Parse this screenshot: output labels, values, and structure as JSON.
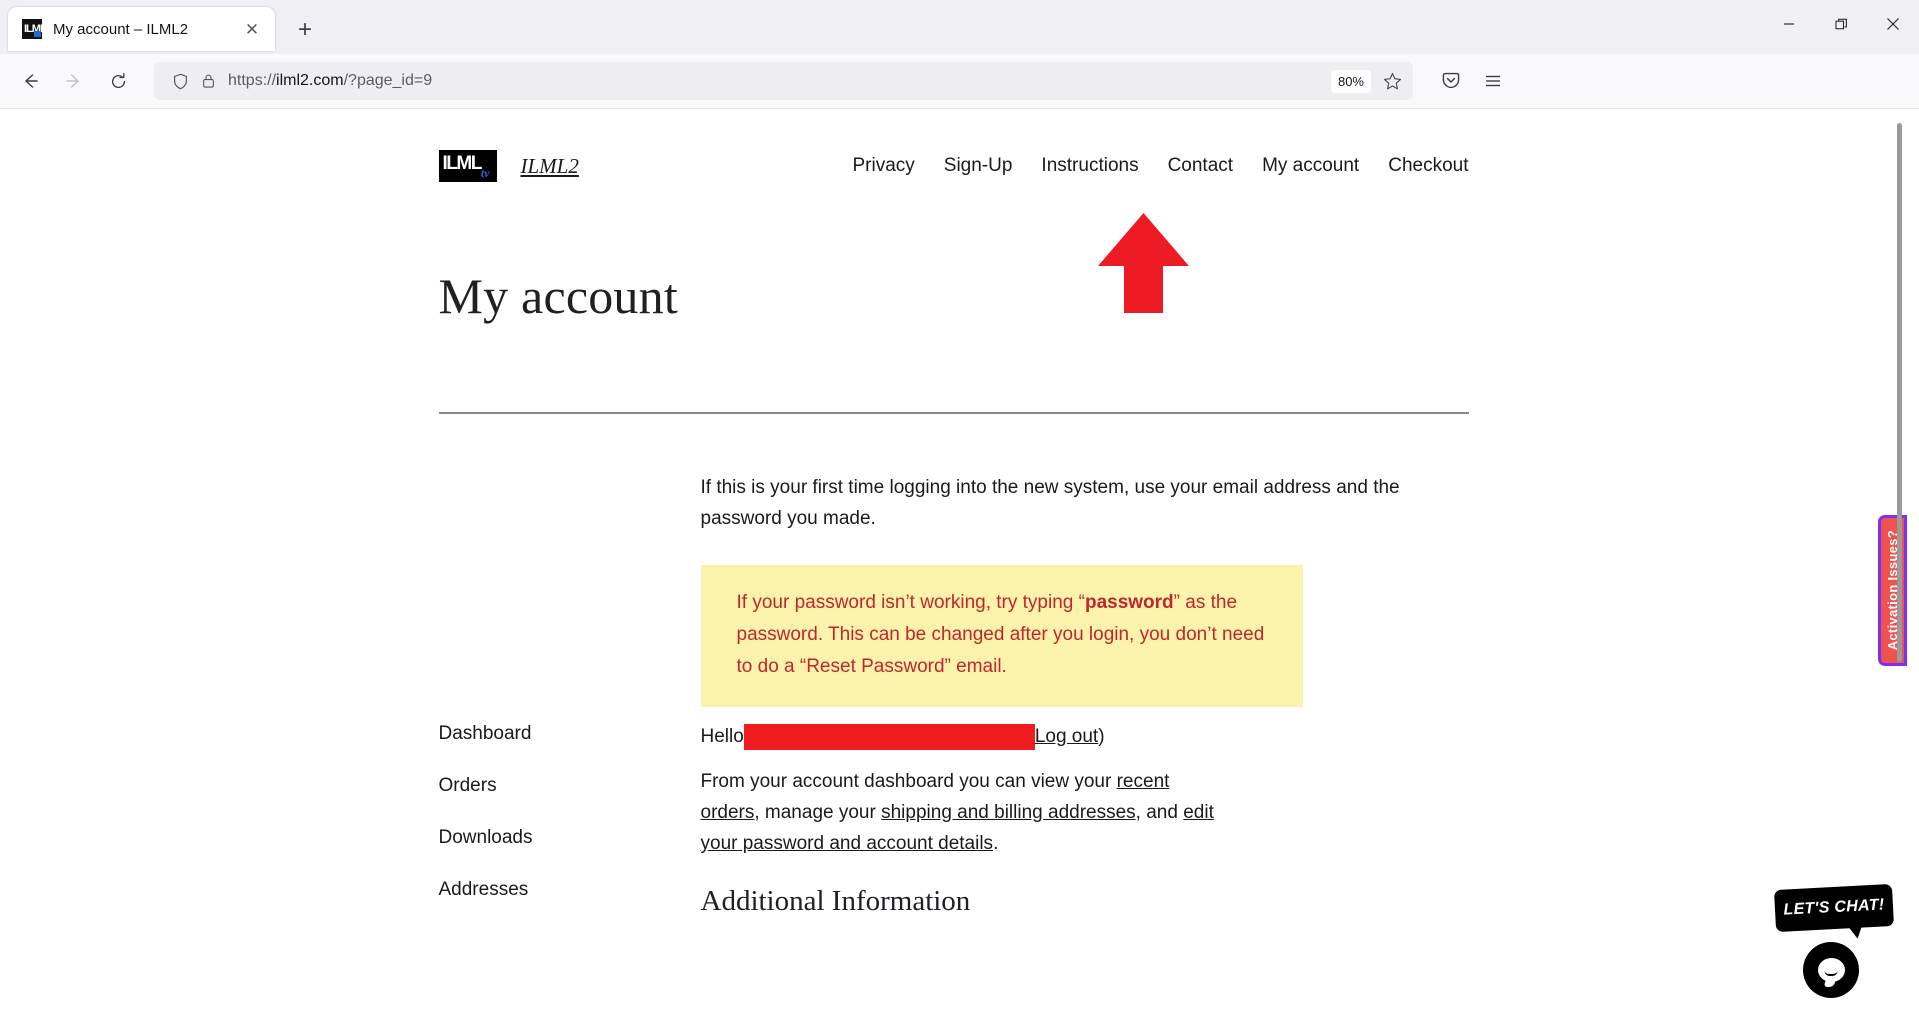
{
  "browser": {
    "tab": {
      "title": "My account – ILML2",
      "favicon_name": "ilml-favicon",
      "close_label": "✕"
    },
    "new_tab_label": "+",
    "window_controls": {
      "minimize": "minimize-icon",
      "maximize": "restore-icon",
      "close": "close-icon"
    },
    "nav": {
      "back": "back-arrow-icon",
      "forward": "forward-arrow-icon",
      "reload": "reload-icon"
    },
    "url": {
      "scheme": "https://",
      "host": "ilml2.com",
      "path": "/?page_id=9",
      "full": "https://ilml2.com/?page_id=9",
      "shield_icon": "shield-icon",
      "lock_icon": "padlock-icon"
    },
    "zoom_level": "80%",
    "bookmark_icon": "star-icon",
    "pocket_icon": "pocket-save-icon",
    "menu_icon": "hamburger-menu-icon"
  },
  "site": {
    "logo": {
      "mark_text": "ILML",
      "mark_sub": "tv",
      "name": "ILML2"
    },
    "nav_items": [
      {
        "label": "Privacy"
      },
      {
        "label": "Sign-Up"
      },
      {
        "label": "Instructions"
      },
      {
        "label": "Contact"
      },
      {
        "label": "My account"
      },
      {
        "label": "Checkout"
      }
    ]
  },
  "annotation": {
    "arrow_color": "#ed1c24",
    "arrow_name": "red-up-arrow-annotation"
  },
  "page": {
    "title": "My account",
    "intro_paragraph": "If this is your first time logging into the new system, use your email address and the password you made.",
    "notice": {
      "background": "#fbf3ab",
      "text_color": "#c0272d",
      "part1": "If your password isn’t working, try typing “",
      "emphasis": "password",
      "part2": "” as the password. This can be changed after you login, you don’t need to do a “Reset Password” email."
    },
    "account_nav": [
      {
        "label": "Dashboard"
      },
      {
        "label": "Orders"
      },
      {
        "label": "Downloads"
      },
      {
        "label": "Addresses"
      }
    ],
    "hello": {
      "greeting": "Hello",
      "redacted_name": "",
      "redaction_color": "#f01c20",
      "logout_label": "Log out",
      "closing_paren": ")"
    },
    "dashboard_text": {
      "part1": "From your account dashboard you can view your ",
      "link1": "recent orders",
      "part2": ", manage your ",
      "link2": "shipping and billing addresses",
      "part3": ", and ",
      "link3": "edit your password and account details",
      "part4": "."
    },
    "additional_heading": "Additional Information"
  },
  "widgets": {
    "activation_tab": {
      "label": "Activation Issues?",
      "background": "#f0524f",
      "border_color": "#7b2ff7"
    },
    "chat": {
      "label": "LET'S CHAT!",
      "bubble_icon": "chat-bubble-icon"
    }
  }
}
